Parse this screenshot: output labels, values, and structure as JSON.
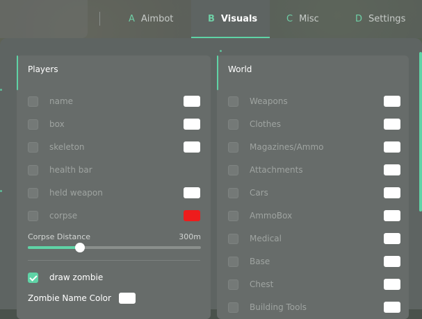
{
  "tabs": [
    {
      "letter": "A",
      "label": "Aimbot",
      "active": false
    },
    {
      "letter": "B",
      "label": "Visuals",
      "active": true
    },
    {
      "letter": "C",
      "label": "Misc",
      "active": false
    },
    {
      "letter": "D",
      "label": "Settings",
      "active": false
    }
  ],
  "players": {
    "title": "Players",
    "items": [
      {
        "label": "name",
        "checked": false,
        "swatch": "#ffffff"
      },
      {
        "label": "box",
        "checked": false,
        "swatch": "#ffffff"
      },
      {
        "label": "skeleton",
        "checked": false,
        "swatch": "#ffffff"
      },
      {
        "label": "health bar",
        "checked": false,
        "swatch": null
      },
      {
        "label": "held weapon",
        "checked": false,
        "swatch": "#ffffff"
      },
      {
        "label": "corpse",
        "checked": false,
        "swatch": "#ee1c1c"
      }
    ],
    "corpse_distance": {
      "label": "Corpse Distance",
      "value_text": "300m",
      "fraction": 0.3
    },
    "draw_zombie": {
      "label": "draw zombie",
      "checked": true
    },
    "zombie_name_color": {
      "label": "Zombie Name Color",
      "swatch": "#ffffff"
    }
  },
  "world": {
    "title": "World",
    "items": [
      {
        "label": "Weapons",
        "checked": false,
        "swatch": "#ffffff"
      },
      {
        "label": "Clothes",
        "checked": false,
        "swatch": "#ffffff"
      },
      {
        "label": "Magazines/Ammo",
        "checked": false,
        "swatch": "#ffffff"
      },
      {
        "label": "Attachments",
        "checked": false,
        "swatch": "#ffffff"
      },
      {
        "label": "Cars",
        "checked": false,
        "swatch": "#ffffff"
      },
      {
        "label": "AmmoBox",
        "checked": false,
        "swatch": "#ffffff"
      },
      {
        "label": "Medical",
        "checked": false,
        "swatch": "#ffffff"
      },
      {
        "label": "Base",
        "checked": false,
        "swatch": "#ffffff"
      },
      {
        "label": "Chest",
        "checked": false,
        "swatch": "#ffffff"
      },
      {
        "label": "Building Tools",
        "checked": false,
        "swatch": "#ffffff"
      }
    ]
  },
  "colors": {
    "accent": "#5fd3a6",
    "panel": "#676c6a",
    "window": "#5e6462"
  }
}
